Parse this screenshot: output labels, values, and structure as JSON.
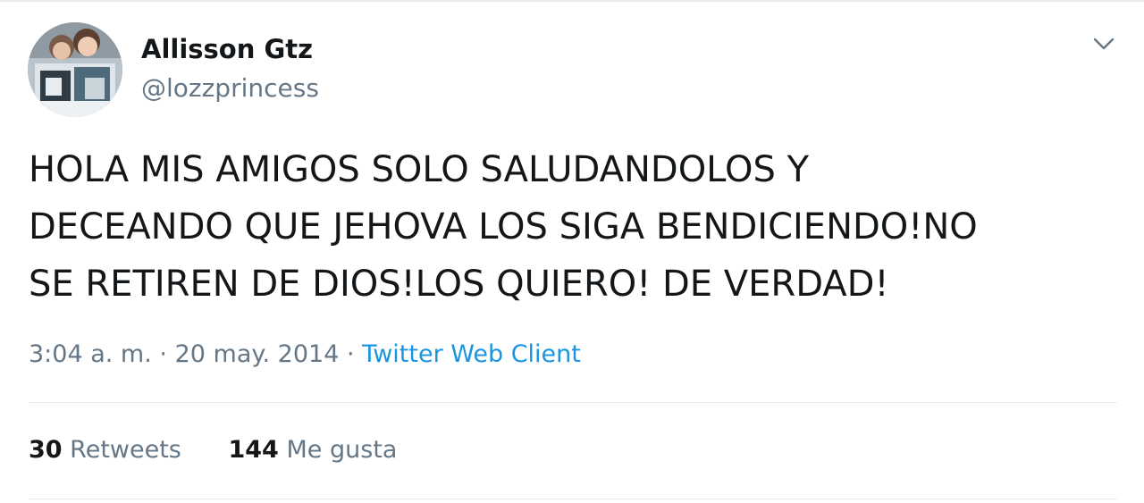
{
  "user": {
    "display_name": "Allisson Gtz",
    "handle": "@lozzprincess"
  },
  "tweet": {
    "lines": [
      "HOLA MIS AMIGOS SOLO SALUDANDOLOS Y",
      "DECEANDO QUE JEHOVA LOS SIGA BENDICIENDO!NO",
      "SE RETIREN DE DIOS!LOS QUIERO! DE VERDAD!"
    ]
  },
  "meta": {
    "time": "3:04 a. m.",
    "separator": "·",
    "date": "20 may. 2014",
    "source": "Twitter Web Client"
  },
  "stats": {
    "retweets_count": "30",
    "retweets_label": "Retweets",
    "likes_count": "144",
    "likes_label": "Me gusta"
  },
  "icons": {
    "menu_caret": "chevron-down-icon"
  },
  "colors": {
    "text_primary": "#14171a",
    "text_secondary": "#657786",
    "link": "#1b95e0",
    "divider": "#e6ecf0"
  }
}
